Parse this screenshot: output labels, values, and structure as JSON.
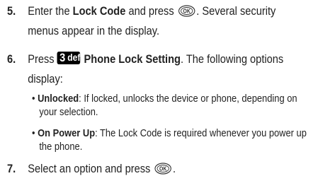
{
  "steps": [
    {
      "number": "5.",
      "text_a": "Enter the ",
      "bold_a": "Lock Code",
      "text_b": " and press ",
      "key": "OK",
      "text_c": ". Several security",
      "line2": "menus appear in the display."
    },
    {
      "number": "6.",
      "text_a": "Press ",
      "key_glyph": "3",
      "key_letters": "def",
      "bold_a": "Phone Lock Setting",
      "text_b": ". The following options",
      "line2": "display:",
      "bullets": [
        {
          "term": "Unlocked",
          "desc_line1": ": If locked, unlocks the device or phone, depending on",
          "desc_line2": "your selection."
        },
        {
          "term": "On Power Up",
          "desc_line1": ": The Lock Code is required whenever you power up",
          "desc_line2": "the phone."
        }
      ]
    },
    {
      "number": "7.",
      "text_a": "Select an option and press ",
      "key": "OK",
      "text_b": "."
    }
  ],
  "icons": {
    "ok_key": "ok-key-icon",
    "key_3": "key-3-def-icon"
  },
  "bullet_symbol": "•"
}
